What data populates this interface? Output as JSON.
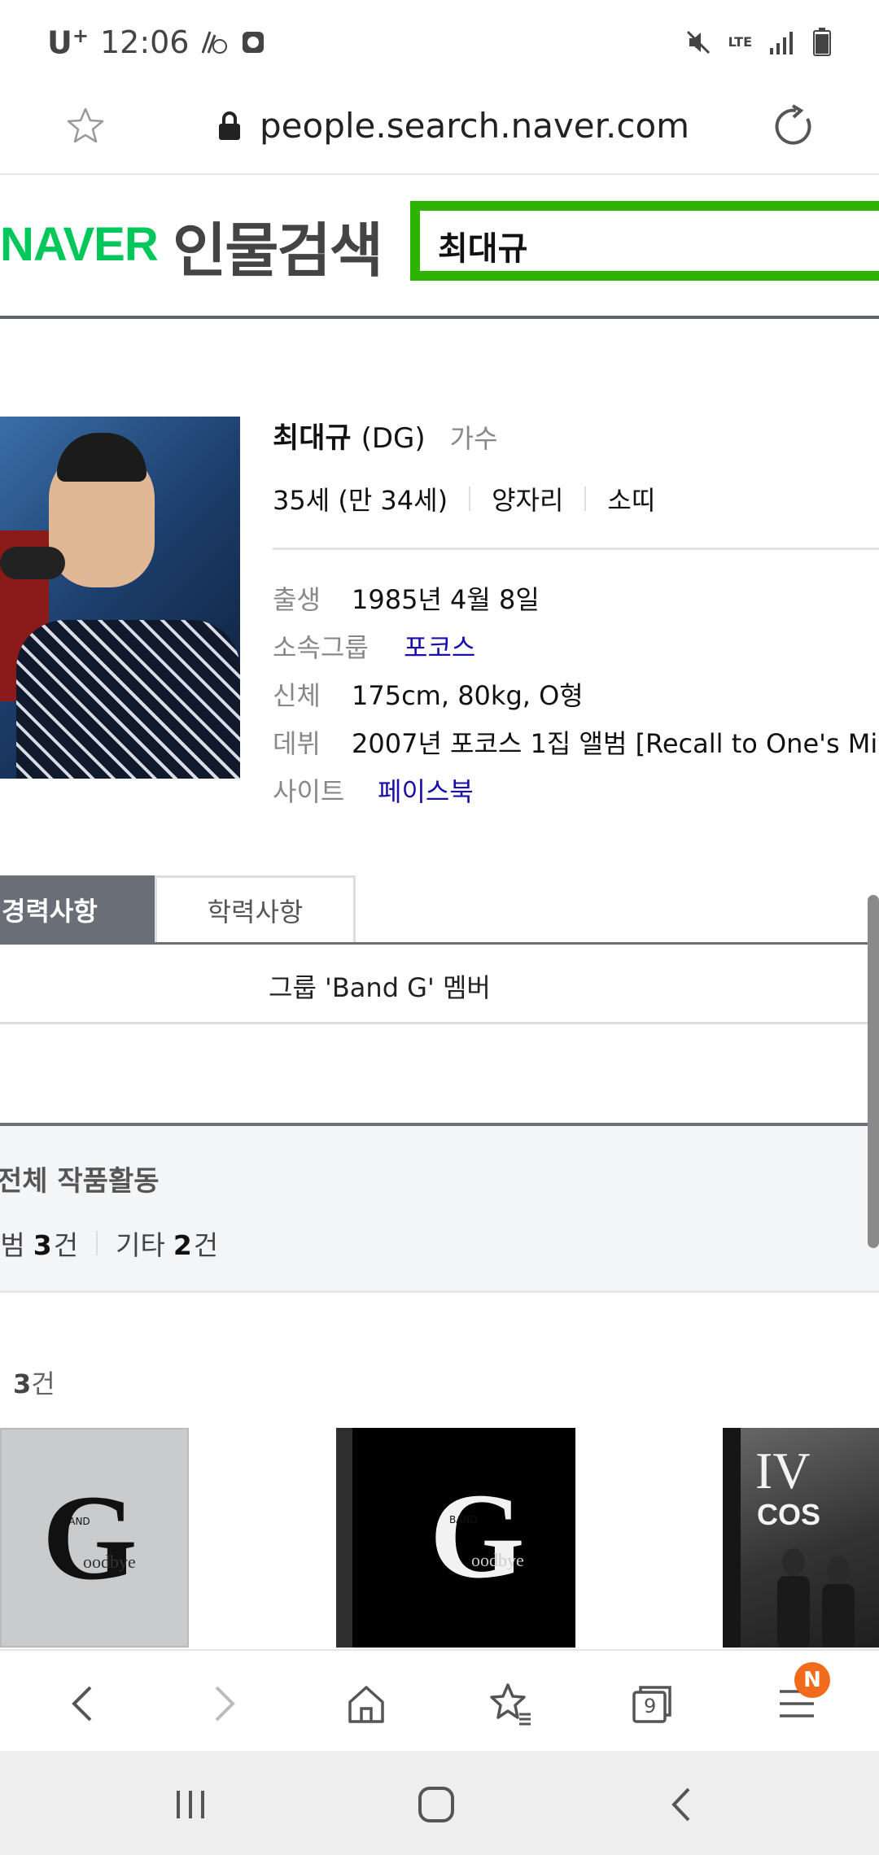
{
  "status": {
    "carrier": "U",
    "carrier_sup": "+",
    "time": "12:06",
    "network": "LTE"
  },
  "url_bar": {
    "url": "people.search.naver.com"
  },
  "naver": {
    "logo": "NAVER",
    "service_title": "인물검색",
    "search_query": "최대규"
  },
  "profile": {
    "name": "최대규",
    "alias": "(DG)",
    "job": "가수",
    "age": "35세 (만 34세)",
    "zodiac": "양자리",
    "chinese_zodiac": "소띠",
    "info": [
      {
        "label": "출생",
        "value": "1985년 4월 8일",
        "link": false
      },
      {
        "label": "소속그룹",
        "value": "포코스",
        "link": true
      },
      {
        "label": "신체",
        "value": "175cm, 80kg, O형",
        "link": false
      },
      {
        "label": "데뷔",
        "value": "2007년 포코스 1집 앨범 [Recall to One's Mi",
        "link": false
      },
      {
        "label": "사이트",
        "value": "페이스북",
        "link": true
      }
    ]
  },
  "tabs": {
    "career": "경력사항",
    "education": "학력사항"
  },
  "career": {
    "item": "그룹 'Band G' 멤버"
  },
  "works": {
    "title": "전체 작품활동",
    "album_label": "앨범",
    "album_count": "3",
    "etc_label": "기타",
    "etc_count": "2",
    "unit": "건"
  },
  "album_section": {
    "count": "3",
    "unit": "건",
    "covers": [
      {
        "main": "G",
        "small": "BAND",
        "sub": "oodbye"
      },
      {
        "main": "G",
        "small": "BAND",
        "sub": "oodbye"
      },
      {
        "main": "IV",
        "sub": "COS"
      }
    ]
  },
  "toolbar": {
    "badge": "N",
    "tabs_count": "9"
  },
  "colors": {
    "naver_green": "#2db400",
    "tab_active": "#6a6e77",
    "link": "#1a0dab",
    "badge": "#f26b1d"
  }
}
